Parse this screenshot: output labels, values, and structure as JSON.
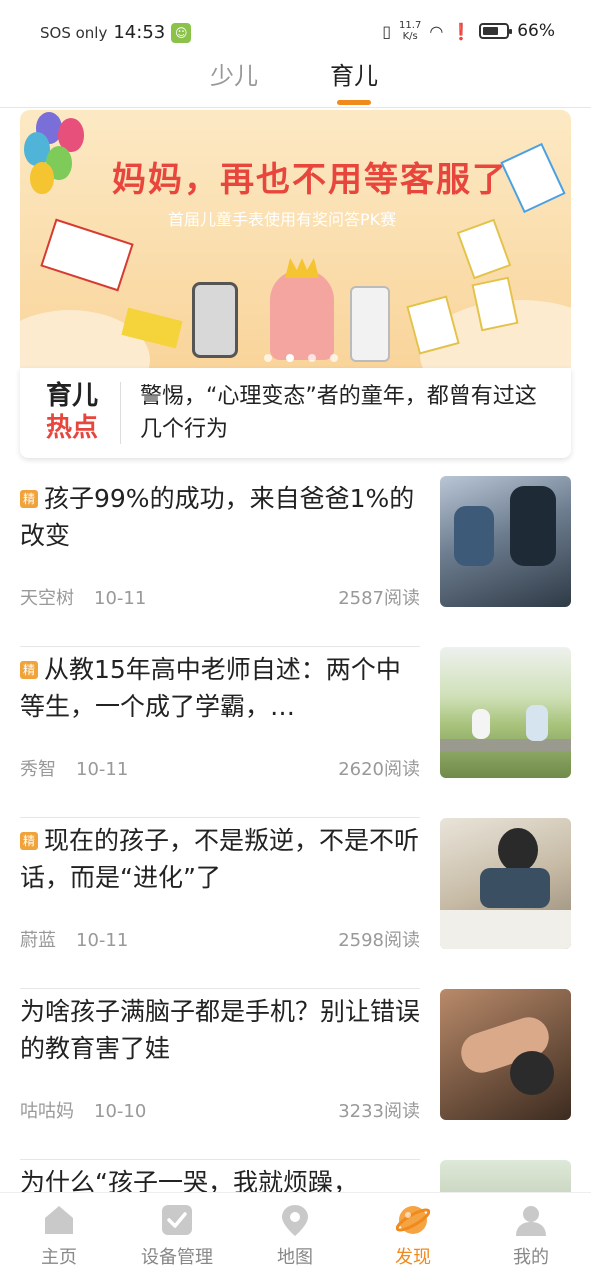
{
  "status_bar": {
    "sos": "SOS only",
    "time": "14:53",
    "net_speed_top": "11.7",
    "net_speed_bottom": "K/s",
    "battery_pct": "66%",
    "battery_level": 0.66
  },
  "tabs": [
    {
      "label": "少儿",
      "active": false
    },
    {
      "label": "育儿",
      "active": true
    }
  ],
  "banner": {
    "title": "妈妈，再也不用等客服了",
    "subtitle": "首届儿童手表使用有奖问答PK赛",
    "slide_count": 4,
    "active_slide": 1
  },
  "hot_topic": {
    "tag_line1": "育儿",
    "tag_line2": "热点",
    "text": "警惕，“心理变态”者的童年，都曾有过这几个行为"
  },
  "articles": [
    {
      "featured": true,
      "badge": "精",
      "title": "孩子99%的成功，来自爸爸1%的改变",
      "author": "天空树",
      "date": "10-11",
      "reads": "2587阅读"
    },
    {
      "featured": true,
      "badge": "精",
      "title": "从教15年高中老师自述：两个中等生，一个成了学霸，…",
      "author": "秀智",
      "date": "10-11",
      "reads": "2620阅读"
    },
    {
      "featured": true,
      "badge": "精",
      "title": "现在的孩子，不是叛逆，不是不听话，而是“进化”了",
      "author": "蔚蓝",
      "date": "10-11",
      "reads": "2598阅读"
    },
    {
      "featured": false,
      "badge": "",
      "title": "为啥孩子满脑子都是手机？别让错误的教育害了娃",
      "author": "咕咕妈",
      "date": "10-10",
      "reads": "3233阅读"
    },
    {
      "featured": false,
      "badge": "",
      "title": "为什么“孩子一哭，我就烦躁，",
      "author": "",
      "date": "",
      "reads": ""
    }
  ],
  "bottom_nav": [
    {
      "label": "主页",
      "icon": "home-icon",
      "active": false
    },
    {
      "label": "设备管理",
      "icon": "device-check-icon",
      "active": false
    },
    {
      "label": "地图",
      "icon": "map-pin-icon",
      "active": false
    },
    {
      "label": "发现",
      "icon": "discover-planet-icon",
      "active": true
    },
    {
      "label": "我的",
      "icon": "person-icon",
      "active": false
    }
  ],
  "colors": {
    "accent": "#f08a1c",
    "hot_red": "#e8453c",
    "badge": "#f0a33a"
  }
}
